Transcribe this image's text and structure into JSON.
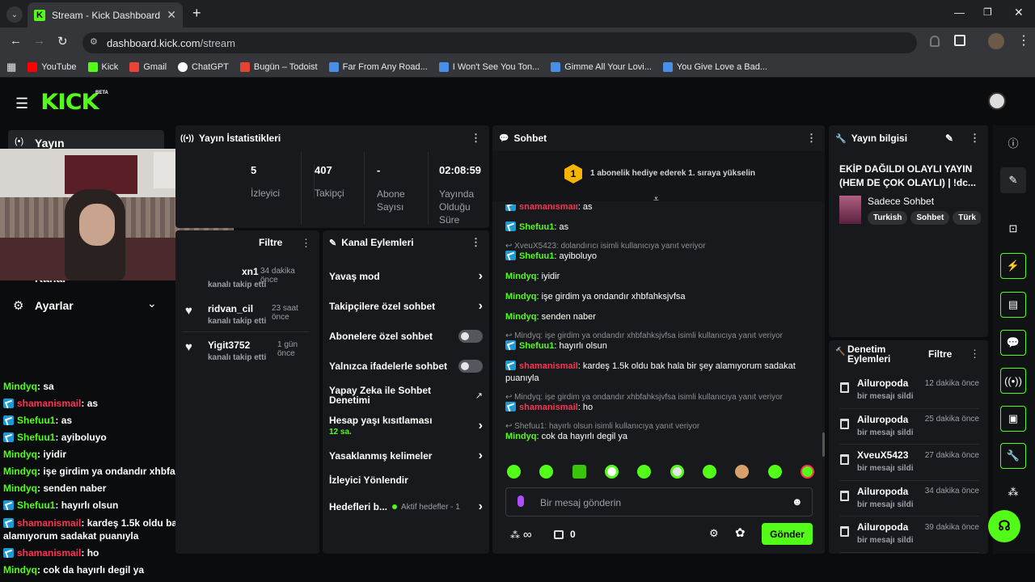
{
  "browser": {
    "tab_title": "Stream - Kick Dashboard",
    "url_host": "dashboard.kick.com",
    "url_path": "/stream",
    "bookmarks": [
      {
        "label": "YouTube",
        "color": "#ff0000"
      },
      {
        "label": "Kick",
        "color": "#53fc18"
      },
      {
        "label": "Gmail",
        "color": "#ea4335"
      },
      {
        "label": "ChatGPT",
        "color": "#ffffff"
      },
      {
        "label": "Bugün – Todoist",
        "color": "#e44332"
      },
      {
        "label": "Far From Any Road...",
        "color": "#4a8fe7"
      },
      {
        "label": "I Won't See You Ton...",
        "color": "#4a8fe7"
      },
      {
        "label": "Gimme All Your Lovi...",
        "color": "#4a8fe7"
      },
      {
        "label": "You Give Love a Bad...",
        "color": "#4a8fe7"
      }
    ]
  },
  "kick": {
    "logo": "KICK",
    "beta": "BETA"
  },
  "left_nav": {
    "stream": "Yayın",
    "channel": "Kanal",
    "settings": "Ayarlar"
  },
  "stats": {
    "title": "Yayın İstatistikleri",
    "items": [
      {
        "value": "5",
        "label": "İzleyici"
      },
      {
        "value": "407",
        "label": "Takipçi"
      },
      {
        "value": "-",
        "label": "Abone Sayısı"
      },
      {
        "value": "02:08:59",
        "label": "Yayında Olduğu Süre"
      }
    ]
  },
  "follows": {
    "filter": "Filtre",
    "items": [
      {
        "name": "xn1",
        "time": "34 dakika önce",
        "action": "kanalı takip etti"
      },
      {
        "name": "ridvan_cil",
        "time": "23 saat önce",
        "action": "kanalı takip etti"
      },
      {
        "name": "Yigit3752",
        "time": "1 gün önce",
        "action": "kanalı takip etti"
      }
    ]
  },
  "channel_actions": {
    "title": "Kanal Eylemleri",
    "slow": "Yavaş mod",
    "followers": "Takipçilere özel sohbet",
    "subs": "Abonelere özel sohbet",
    "emotes": "Yalnızca ifadelerle sohbet",
    "ai": "Yapay Zeka ile Sohbet Denetimi",
    "age": "Hesap yaşı kısıtlaması",
    "age_value": "12 sa.",
    "banned": "Yasaklanmış kelimeler",
    "redirect": "İzleyici Yönlendir",
    "goals": "Hedefleri b...",
    "goals_status": "Aktif hedefler - 1"
  },
  "chat": {
    "title": "Sohbet",
    "gift_rank": "1",
    "gift_text": "1 abonelik hediye ederek 1. sıraya yükselin",
    "messages": [
      {
        "user": "shamanismail",
        "color": "#ff3352",
        "text": "as",
        "badge": true
      },
      {
        "user": "Shefuu1",
        "color": "#53fc18",
        "text": "as",
        "badge": true
      },
      {
        "reply": "XveuX5423: dolandırıcı isimli kullanıcıya yanıt veriyor"
      },
      {
        "user": "Shefuu1",
        "color": "#53fc18",
        "text": "ayiboluyo",
        "badge": true
      },
      {
        "user": "Mindyq",
        "color": "#53fc18",
        "text": "iyidir",
        "badge": false
      },
      {
        "user": "Mindyq",
        "color": "#53fc18",
        "text": "işe girdim ya ondandır xhbfahksjvfsa",
        "badge": false
      },
      {
        "user": "Mindyq",
        "color": "#53fc18",
        "text": "senden naber",
        "badge": false
      },
      {
        "reply": "Mindyq: işe girdim ya ondandır xhbfahksjvfsa isimli kullanıcıya yanıt veriyor"
      },
      {
        "user": "Shefuu1",
        "color": "#53fc18",
        "text": "hayırlı olsun",
        "badge": true
      },
      {
        "user": "shamanismail",
        "color": "#ff3352",
        "text": "kardeş 1.5k oldu bak hala bir şey alamıyorum sadakat puanıyla",
        "badge": true
      },
      {
        "reply": "Mindyq: işe girdim ya ondandır xhbfahksjvfsa isimli kullanıcıya yanıt veriyor"
      },
      {
        "user": "shamanismail",
        "color": "#ff3352",
        "text": "ho",
        "badge": true
      },
      {
        "reply": "Shefuu1: hayırlı olsun isimli kullanıcıya yanıt veriyor"
      },
      {
        "user": "Mindyq",
        "color": "#53fc18",
        "text": "cok da hayırlı degil ya",
        "badge": false
      }
    ],
    "placeholder": "Bir mesaj gönderin",
    "points": "∞",
    "chest_count": "0",
    "send": "Gönder"
  },
  "info": {
    "title": "Yayın bilgisi",
    "stream_title": "EKİP DAĞILDI OLAYLI YAYIN (HEM DE ÇOK OLAYLI) | !dc...",
    "category": "Sadece Sohbet",
    "tags": [
      "Turkish",
      "Sohbet",
      "Türk"
    ]
  },
  "moderation": {
    "title": "Denetim Eylemleri",
    "filter": "Filtre",
    "items": [
      {
        "user": "Ailuropoda",
        "time": "12 dakika önce",
        "action": "bir mesajı sildi"
      },
      {
        "user": "Ailuropoda",
        "time": "25 dakika önce",
        "action": "bir mesajı sildi"
      },
      {
        "user": "XveuX5423",
        "time": "27 dakika önce",
        "action": "bir mesajı sildi"
      },
      {
        "user": "Ailuropoda",
        "time": "34 dakika önce",
        "action": "bir mesajı sildi"
      },
      {
        "user": "Ailuropoda",
        "time": "39 dakika önce",
        "action": "bir mesajı sildi"
      }
    ]
  },
  "overlay_chat": [
    {
      "user": "Mindyq",
      "color": "#53fc18",
      "text": "sa",
      "badge": false
    },
    {
      "user": "shamanismail",
      "color": "#ff3352",
      "text": "as",
      "badge": true
    },
    {
      "user": "Shefuu1",
      "color": "#53fc18",
      "text": "as",
      "badge": true
    },
    {
      "user": "Shefuu1",
      "color": "#53fc18",
      "text": "ayiboluyo",
      "badge": true
    },
    {
      "user": "Mindyq",
      "color": "#53fc18",
      "text": "iyidir",
      "badge": false
    },
    {
      "user": "Mindyq",
      "color": "#53fc18",
      "text": "işe girdim ya ondandır xhbfahksjvfsa",
      "badge": false
    },
    {
      "user": "Mindyq",
      "color": "#53fc18",
      "text": "senden naber",
      "badge": false
    },
    {
      "user": "Shefuu1",
      "color": "#53fc18",
      "text": "hayırlı olsun",
      "badge": true
    },
    {
      "user": "shamanismail",
      "color": "#ff3352",
      "text": "kardeş 1.5k oldu bak hala bir şey alamıyorum sadakat puanıyla",
      "badge": true
    },
    {
      "user": "shamanismail",
      "color": "#ff3352",
      "text": "ho",
      "badge": true
    },
    {
      "user": "Mindyq",
      "color": "#53fc18",
      "text": "cok da hayırlı degil ya",
      "badge": false
    }
  ]
}
